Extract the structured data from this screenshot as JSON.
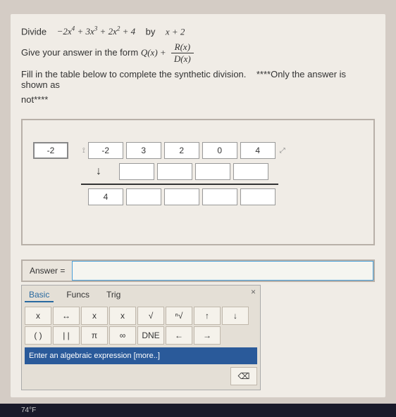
{
  "problem": {
    "divide_label": "Divide",
    "polynomial": "−2x⁴ + 3x³ + 2x² + 4",
    "by_label": "by",
    "divisor": "x + 2",
    "form_intro": "Give your answer in the form",
    "q_of_x": "Q(x) +",
    "r_of_x": "R(x)",
    "d_of_x": "D(x)",
    "fill_label": "Fill in the table below to complete the synthetic division.",
    "note_prefix": "****",
    "note_text": "Only the answer is shown as",
    "not_label": "not",
    "note_suffix": "****"
  },
  "synthetic": {
    "left_value": "-2",
    "row1": [
      "-2",
      "3",
      "2",
      "0",
      "4"
    ],
    "row2": [
      "",
      "",
      "",
      "",
      ""
    ],
    "row3": [
      "4",
      "",
      "",
      "",
      ""
    ],
    "handle_left": "⟟",
    "handle_right": "⤢"
  },
  "answer_section": {
    "label": "Answer =",
    "value": ""
  },
  "keypad": {
    "tabs": {
      "basic": "Basic",
      "funcs": "Funcs",
      "trig": "Trig"
    },
    "close": "×",
    "r1": {
      "k1": "x",
      "k2": "↔",
      "k3": "x",
      "k4": "x",
      "k5": "√",
      "k6": "ⁿ√",
      "k7": "↑",
      "k8": "↓"
    },
    "r2": {
      "k1": "( )",
      "k2": "| |",
      "k3": "π",
      "k4": "∞",
      "k5": "DNE",
      "k6": "←",
      "k7": "→"
    },
    "info_text": "Enter an algebraic expression [more..]",
    "backspace": "⌫"
  },
  "taskbar": {
    "temp": "74°F"
  }
}
